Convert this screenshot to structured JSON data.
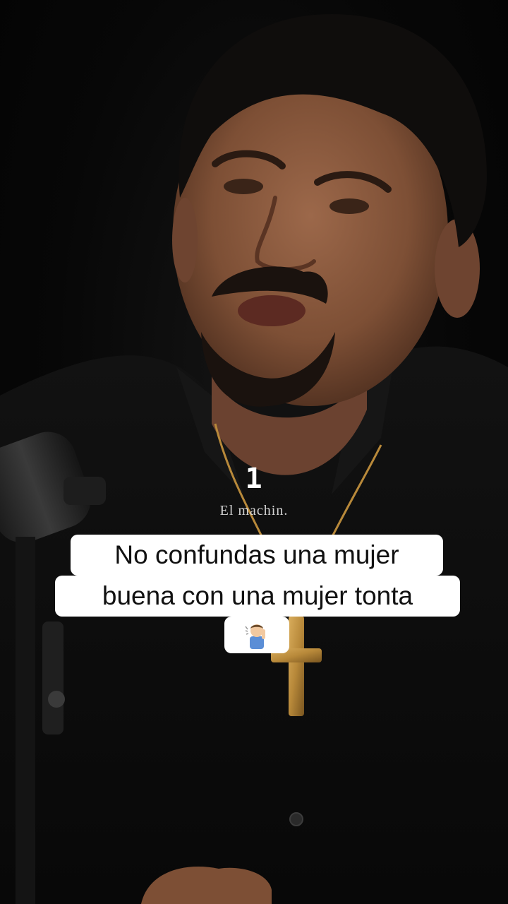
{
  "overlay": {
    "counter": "1",
    "handle": "El machin."
  },
  "caption": {
    "line1": "No confundas una mujer",
    "line2": "buena con una mujer tonta",
    "emoji": "man-gesturing-icon"
  },
  "colors": {
    "background": "#050505",
    "shirt": "#0d0d0d",
    "skin": "#8a5a3e",
    "caption_bg": "#ffffff",
    "caption_text": "#111111",
    "gold": "#b8893a"
  }
}
